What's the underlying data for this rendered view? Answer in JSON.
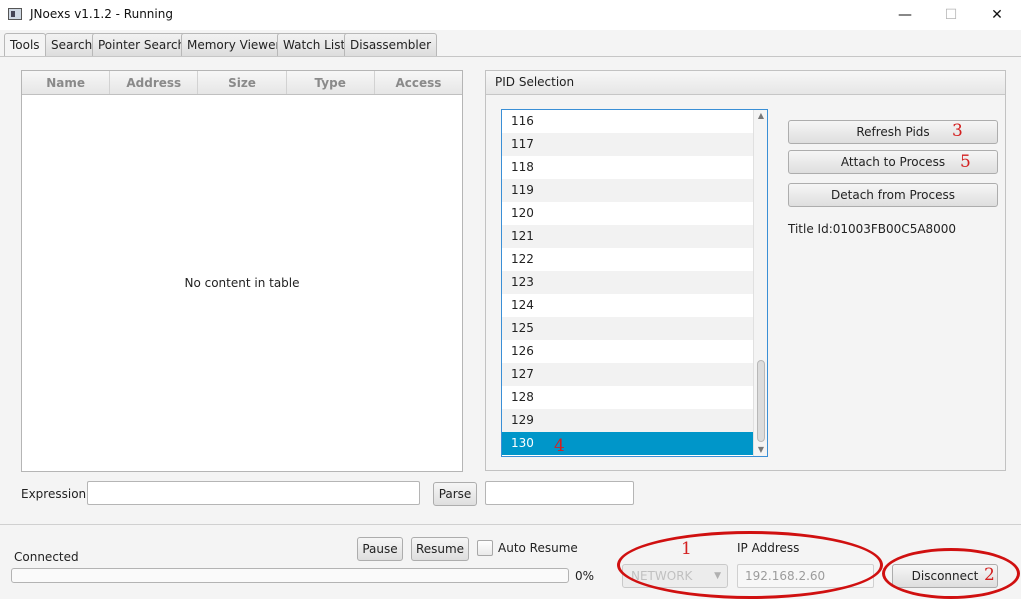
{
  "window": {
    "title": "JNoexs v1.1.2 - Running",
    "minimize": "—",
    "maximize": "☐",
    "close": "✕"
  },
  "tabs": [
    {
      "label": "Tools"
    },
    {
      "label": "Search"
    },
    {
      "label": "Pointer Search"
    },
    {
      "label": "Memory Viewer"
    },
    {
      "label": "Watch List"
    },
    {
      "label": "Disassembler"
    }
  ],
  "table": {
    "columns": [
      "Name",
      "Address",
      "Size",
      "Type",
      "Access"
    ],
    "empty_message": "No content in table"
  },
  "expression": {
    "label": "Expression:",
    "value": "",
    "parse_label": "Parse",
    "result": ""
  },
  "pid_panel": {
    "title": "PID Selection",
    "pids": [
      "116",
      "117",
      "118",
      "119",
      "120",
      "121",
      "122",
      "123",
      "124",
      "125",
      "126",
      "127",
      "128",
      "129",
      "130"
    ],
    "selected": "130",
    "refresh_label": "Refresh Pids",
    "attach_label": "Attach to Process",
    "detach_label": "Detach from Process",
    "title_id": "Title Id:01003FB00C5A8000"
  },
  "bottom": {
    "status": "Connected",
    "progress_percent": 0,
    "progress_text": "0%",
    "pause_label": "Pause",
    "resume_label": "Resume",
    "auto_resume_label": "Auto Resume",
    "connection_type": "NETWORK",
    "ip_label": "IP Address",
    "ip_value": "192.168.2.60",
    "disconnect_label": "Disconnect"
  },
  "annotations": {
    "a1": "1",
    "a2": "2",
    "a3": "3",
    "a4": "4",
    "a5": "5"
  },
  "colors": {
    "selection": "#0096c9",
    "annotation": "#d32020"
  }
}
